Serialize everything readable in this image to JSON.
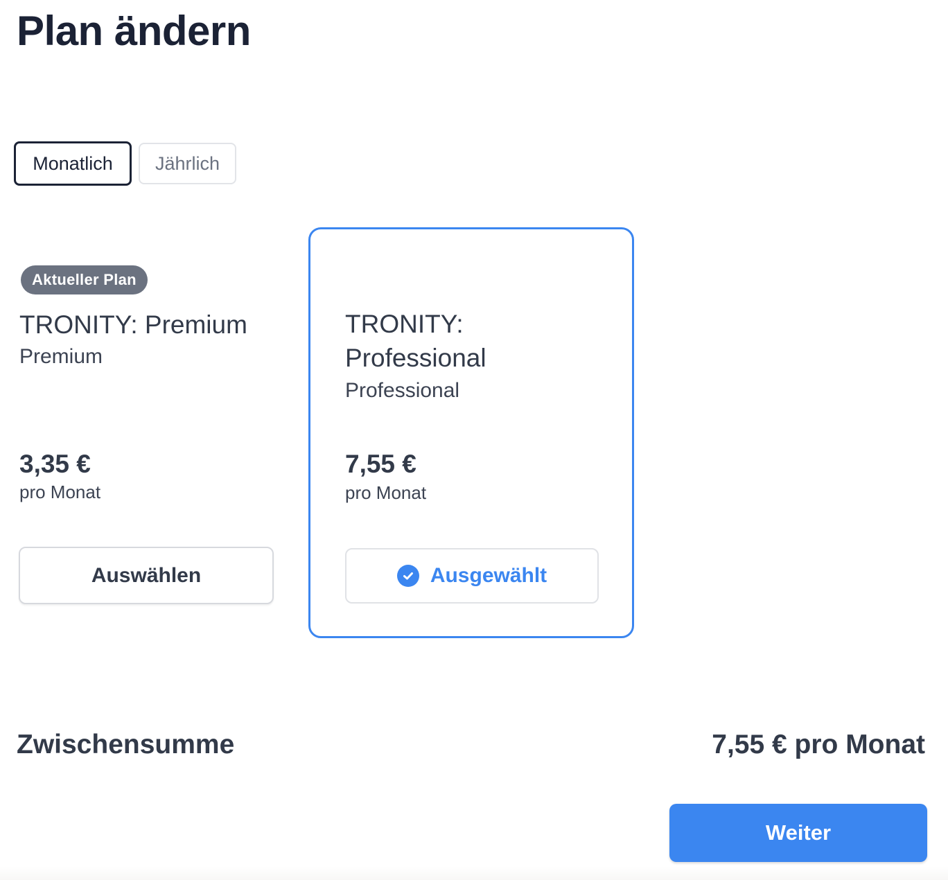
{
  "page": {
    "title": "Plan ändern"
  },
  "billing_toggle": {
    "monthly_label": "Monatlich",
    "yearly_label": "Jährlich",
    "active": "Monatlich"
  },
  "plans": [
    {
      "badge": "Aktueller Plan",
      "name": "TRONITY: Premium",
      "subtitle": "Premium",
      "price": "3,35 €",
      "period": "pro Monat",
      "action_label": "Auswählen",
      "selected": false
    },
    {
      "badge": "",
      "name": "TRONITY: Professional",
      "subtitle": "Professional",
      "price": "7,55 €",
      "period": "pro Monat",
      "action_label": "Ausgewählt",
      "selected": true,
      "action_icon": "check-circle-icon"
    }
  ],
  "summary": {
    "label": "Zwischensumme",
    "value": "7,55 € pro Monat"
  },
  "footer": {
    "next_label": "Weiter"
  },
  "colors": {
    "accent": "#3b86f0",
    "text_dark": "#1b2235",
    "badge_bg": "#6b7280"
  }
}
